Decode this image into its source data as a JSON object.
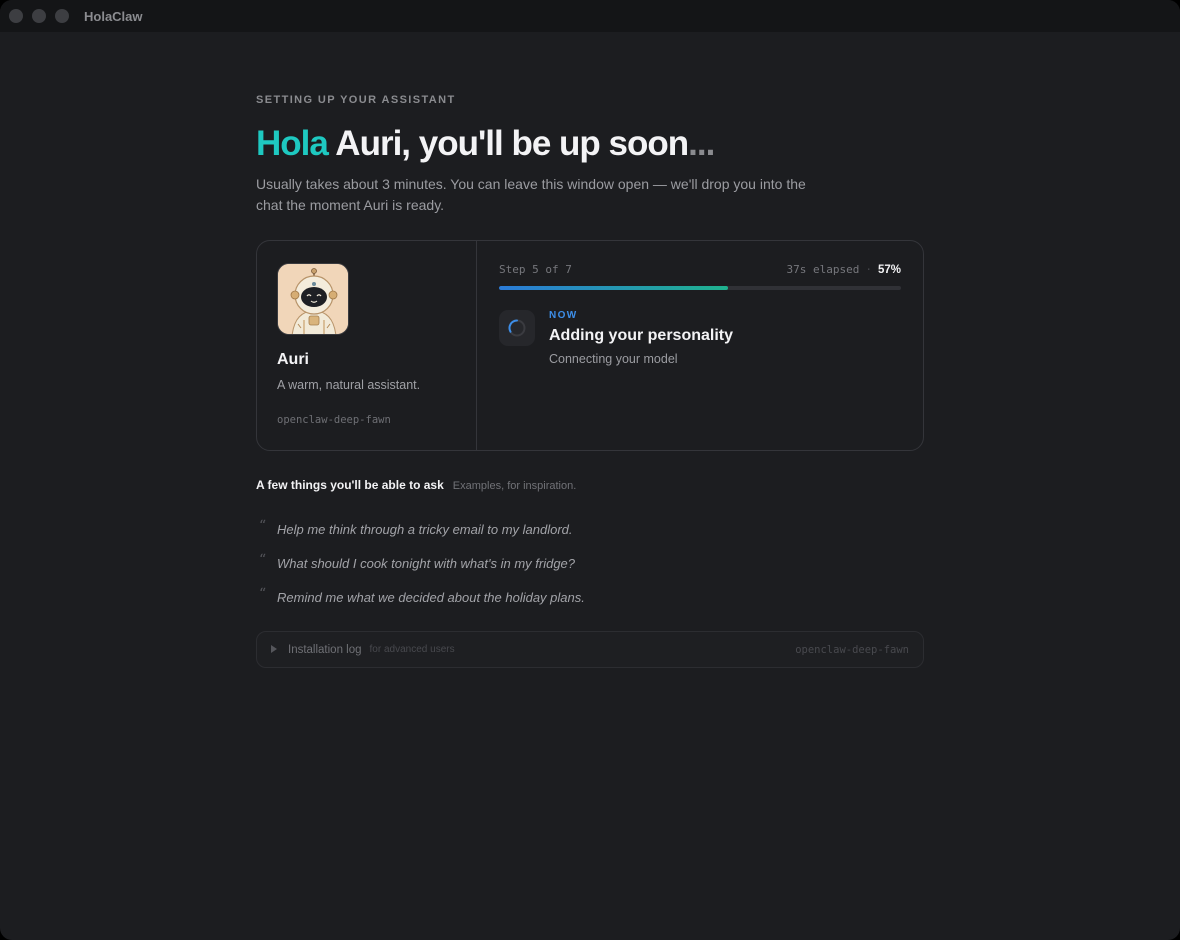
{
  "window": {
    "app_title": "HolaClaw"
  },
  "header": {
    "eyebrow": "SETTING UP YOUR ASSISTANT",
    "greeting": "Hola",
    "headline_rest": "Auri, you'll be up soon",
    "ellipsis": "...",
    "subtitle": "Usually takes about 3 minutes. You can leave this window open — we'll drop you into the chat the moment Auri is ready."
  },
  "agent": {
    "name": "Auri",
    "description": "A warm, natural assistant.",
    "id": "openclaw-deep-fawn",
    "avatar_icon": "robot-astronaut-avatar"
  },
  "progress": {
    "step_label": "Step 5 of 7",
    "elapsed": "37s elapsed",
    "separator": "·",
    "percent_label": "57%",
    "fraction": 0.57,
    "now_label": "NOW",
    "current_title": "Adding your personality",
    "current_detail": "Connecting your model",
    "spinner_icon": "spinner-icon"
  },
  "examples": {
    "title": "A few things you'll be able to ask",
    "subtitle": "Examples, for inspiration.",
    "quote_mark": "“",
    "items": [
      "Help me think through a tricky email to my landlord.",
      "What should I cook tonight with what's in my fridge?",
      "Remind me what we decided about the holiday plans."
    ]
  },
  "install_log": {
    "label": "Installation log",
    "hint": "for advanced users",
    "id": "openclaw-deep-fawn",
    "arrow_icon": "disclosure-triangle-icon"
  },
  "colors": {
    "accent": "#1ec9c1",
    "now_blue": "#3d8ee8",
    "progress_start": "#2b7bd8",
    "progress_end": "#1fb28e"
  }
}
